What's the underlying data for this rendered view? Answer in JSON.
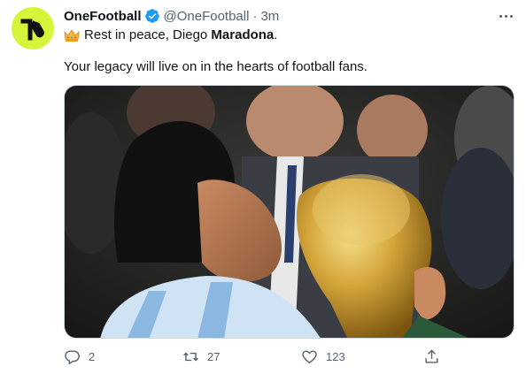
{
  "tweet": {
    "display_name": "OneFootball",
    "handle": "@OneFootball",
    "separator": "·",
    "time": "3m",
    "line1_prefix": "Rest in peace, Diego ",
    "line1_bold": "Maradona",
    "line1_suffix": ".",
    "line2": "Your legacy will live on in the hearts of football fans.",
    "avatar_color": "#d6f53a"
  },
  "icons": {
    "avatar": "onefootball-logo-icon",
    "verified": "verified-badge-icon",
    "crown": "crown-emoji-icon",
    "more": "more-options-icon",
    "reply": "reply-icon",
    "retweet": "retweet-icon",
    "like": "heart-icon",
    "share": "share-icon"
  },
  "actions": {
    "replies": "2",
    "retweets": "27",
    "likes": "123"
  },
  "colors": {
    "verified": "#1d9bf0",
    "secondary_text": "#536471",
    "primary_text": "#0f1419"
  }
}
